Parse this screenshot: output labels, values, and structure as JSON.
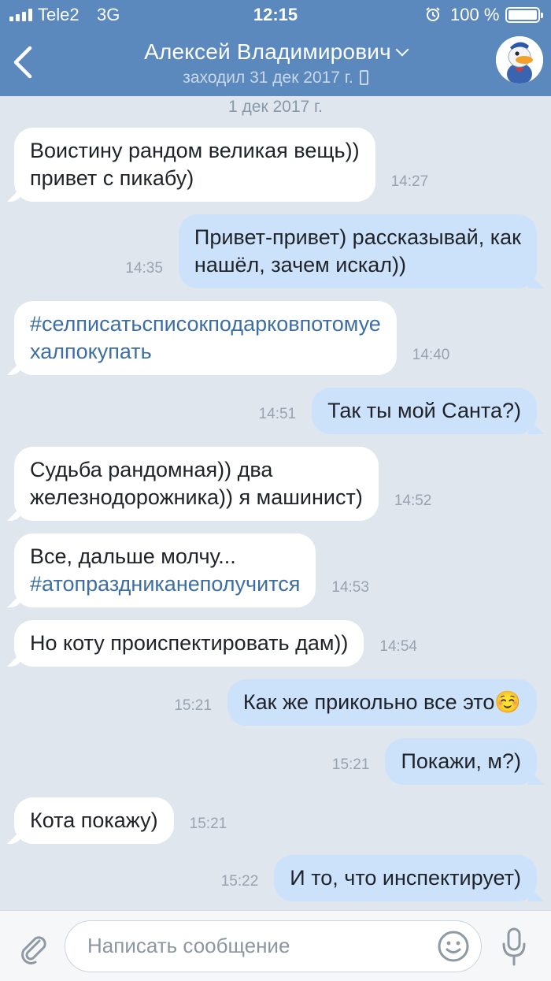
{
  "status_bar": {
    "carrier": "Tele2",
    "network": "3G",
    "time": "12:15",
    "battery_percent": "100 %",
    "battery_level": 1.0
  },
  "header": {
    "contact_name": "Алексей Владимирович",
    "last_seen": "заходил 31 дек 2017 г."
  },
  "chat": {
    "date_separator": "1 дек 2017 г.",
    "messages": [
      {
        "dir": "in",
        "lines": [
          "Воистину рандом великая вещь))",
          "привет с пикабу)"
        ],
        "time": "14:27"
      },
      {
        "dir": "out",
        "lines": [
          "Привет-привет) рассказывай, как",
          "нашёл, зачем искал))"
        ],
        "time": "14:35"
      },
      {
        "dir": "in",
        "lines": [
          "#селписатьсписокподарковпотомуе",
          "халпокупать"
        ],
        "tag_lines": [
          0,
          1
        ],
        "time": "14:40"
      },
      {
        "dir": "out",
        "lines": [
          "Так ты мой Санта?)"
        ],
        "time": "14:51"
      },
      {
        "dir": "in",
        "lines": [
          "Судьба рандомная)) два",
          "железнодорожника)) я машинист)"
        ],
        "time": "14:52"
      },
      {
        "dir": "in",
        "lines": [
          "Все, дальше молчу...",
          "#атопраздниканеполучится"
        ],
        "tag_lines": [
          1
        ],
        "time": "14:53"
      },
      {
        "dir": "in",
        "lines": [
          "Но коту происпектировать дам))"
        ],
        "time": "14:54"
      },
      {
        "dir": "out",
        "lines": [
          "Как же прикольно все это☺️"
        ],
        "time": "15:21"
      },
      {
        "dir": "out",
        "lines": [
          "Покажи, м?)"
        ],
        "time": "15:21"
      },
      {
        "dir": "in",
        "lines": [
          "Кота покажу)"
        ],
        "time": "15:21"
      },
      {
        "dir": "out",
        "lines": [
          "И то, что инспектирует)"
        ],
        "time": "15:22"
      }
    ]
  },
  "composer": {
    "placeholder": "Написать сообщение"
  },
  "colors": {
    "header": "#5b88bd",
    "background": "#dfe6ee",
    "incoming_bubble": "#ffffff",
    "outgoing_bubble": "#cce2fb",
    "hashtag": "#3d6ea3"
  },
  "icons": [
    "signal-icon",
    "alarm-icon",
    "battery-icon",
    "back-icon",
    "chevron-down-icon",
    "phone-icon",
    "avatar",
    "paperclip-icon",
    "emoji-icon",
    "microphone-icon"
  ]
}
